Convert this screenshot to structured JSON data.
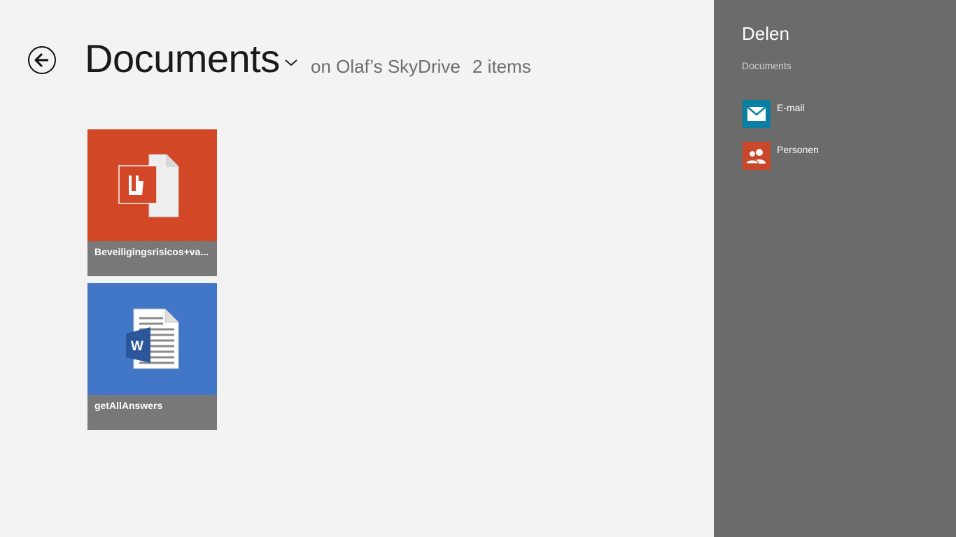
{
  "header": {
    "title": "Documents",
    "location": "on Olaf’s SkyDrive",
    "count": "2 items"
  },
  "files": [
    {
      "name": "Beveiligingsrisicos+va...",
      "type": "pdf",
      "color": "#d24726",
      "icon": "pdf-file-icon"
    },
    {
      "name": "getAllAnswers",
      "type": "word",
      "color": "#4277c8",
      "icon": "word-file-icon"
    }
  ],
  "share_pane": {
    "title": "Delen",
    "subtitle": "Documents",
    "items": [
      {
        "label": "E-mail",
        "icon": "mail-icon",
        "color": "#0b7fa2"
      },
      {
        "label": "Personen",
        "icon": "people-icon",
        "color": "#c9472a"
      }
    ]
  }
}
